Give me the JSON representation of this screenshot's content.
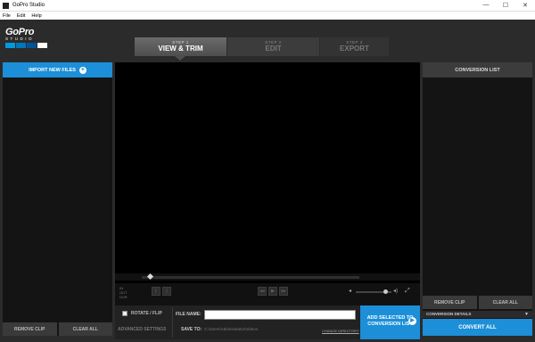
{
  "window": {
    "title": "GoPro Studio",
    "minimize": "—",
    "maximize": "☐",
    "close": "✕"
  },
  "menu": [
    "File",
    "Edit",
    "Help"
  ],
  "logo": {
    "word": "GoPro",
    "sub": "STUDIO",
    "block_colors": [
      "#0099dd",
      "#0077bb",
      "#005599",
      "#ffffff"
    ]
  },
  "steps": [
    {
      "number": "STEP 1",
      "title": "VIEW & TRIM",
      "active": true
    },
    {
      "number": "STEP 2",
      "title": "EDIT",
      "active": false
    },
    {
      "number": "STEP 3",
      "title": "EXPORT",
      "active": false
    }
  ],
  "left_panel": {
    "import_label": "IMPORT NEW FILES",
    "remove_clip": "REMOVE CLIP",
    "clear_all": "CLEAR ALL"
  },
  "player": {
    "timecode": "IN\nOUT\nDUR",
    "playhead_fraction": 0.03
  },
  "bottom": {
    "rotate_flip": "ROTATE / FLIP",
    "advanced_settings": "ADVANCED SETTINGS",
    "file_name_label": "FILE NAME:",
    "file_name_value": "",
    "save_to_label": "SAVE TO:",
    "save_to_path": "C:\\Users\\Administrator\\Videos",
    "change_directory": "CHANGE DIRECTORY",
    "add_selected": "ADD SELECTED TO CONVERSION LIST"
  },
  "right_panel": {
    "header": "CONVERSION LIST",
    "remove_clip": "REMOVE CLIP",
    "clear_all": "CLEAR ALL",
    "conversion_details": "CONVERSION DETAILS",
    "convert_all": "CONVERT ALL"
  },
  "colors": {
    "accent": "#1c8fd8",
    "background": "#2b2b2b",
    "panel": "#141414"
  }
}
